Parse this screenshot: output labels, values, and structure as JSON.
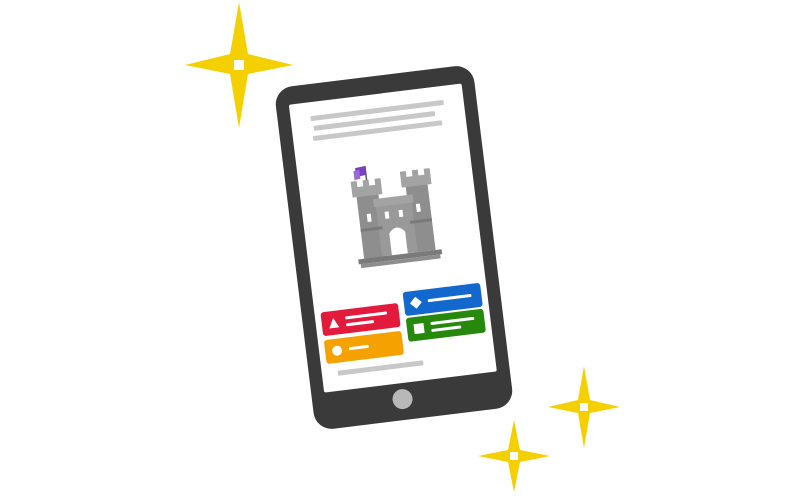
{
  "colors": {
    "sparkle": "#f5d000",
    "tablet_body": "#3a3a3a",
    "screen": "#ffffff",
    "placeholder_line": "#c8c8c8",
    "castle": "#8e8e8e",
    "flag": "#7b3fc4",
    "answer_red": "#e21b3c",
    "answer_blue": "#1368ce",
    "answer_orange": "#f5a200",
    "answer_green": "#26890c"
  },
  "icons": {
    "sparkles": [
      "sparkle-icon",
      "sparkle-icon",
      "sparkle-icon"
    ],
    "illustration": "castle-icon",
    "answers": [
      "triangle-icon",
      "diamond-icon",
      "circle-icon",
      "square-icon"
    ]
  }
}
